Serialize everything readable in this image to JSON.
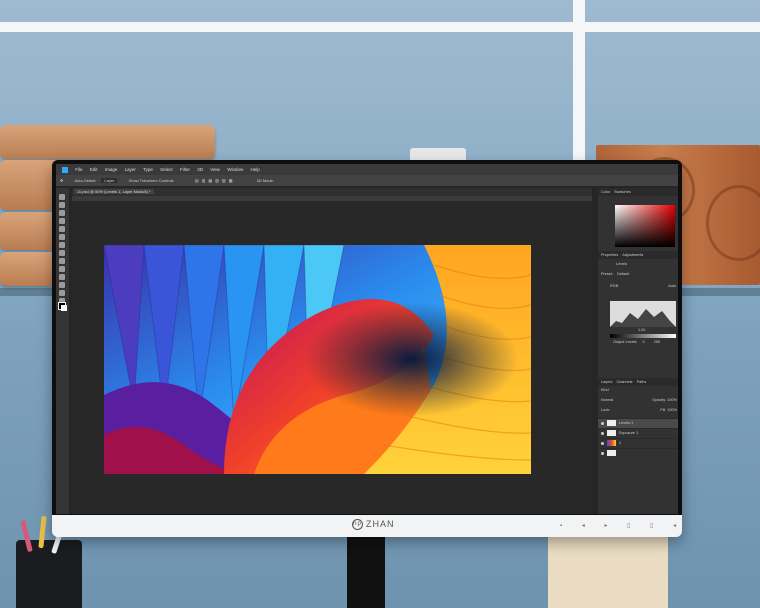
{
  "monitor": {
    "brand": "ZHAN",
    "brand_logo": "hp",
    "buttons": "▪ ◂ ▸ ▯ ▯ ◂"
  },
  "app": {
    "menu": [
      "File",
      "Edit",
      "Image",
      "Layer",
      "Type",
      "Select",
      "Filter",
      "3D",
      "View",
      "Window",
      "Help"
    ],
    "options_bar": {
      "auto_select_label": "Auto-Select:",
      "auto_select_value": "Layer",
      "transform_label": "Show Transform Controls",
      "mode_label": "3D Mode:"
    },
    "document_tab": "11.psd @ 50% (Levels 1, Layer Mask/8) *",
    "panels": {
      "color_tabs": [
        "Color",
        "Swatches"
      ],
      "properties_tabs": [
        "Properties",
        "Adjustments"
      ],
      "properties_title": "Levels",
      "preset_label": "Preset:",
      "preset_value": "Default",
      "channel_value": "RGB",
      "auto_label": "Auto",
      "input_mid_value": "1.00",
      "output_label": "Output Levels:",
      "output_min": "0",
      "output_max": "255",
      "layers_tabs": [
        "Layers",
        "Channels",
        "Paths"
      ],
      "kind_label": "Kind",
      "blend_mode": "Normal",
      "opacity_label": "Opacity:",
      "opacity_value": "100%",
      "lock_label": "Lock:",
      "fill_label": "Fill:",
      "fill_value": "100%",
      "layers": [
        {
          "name": "Levels 1",
          "selected": true
        },
        {
          "name": "Exposure 1",
          "selected": false
        },
        {
          "name": "1",
          "selected": false
        },
        {
          "name": "",
          "selected": false
        }
      ]
    }
  }
}
